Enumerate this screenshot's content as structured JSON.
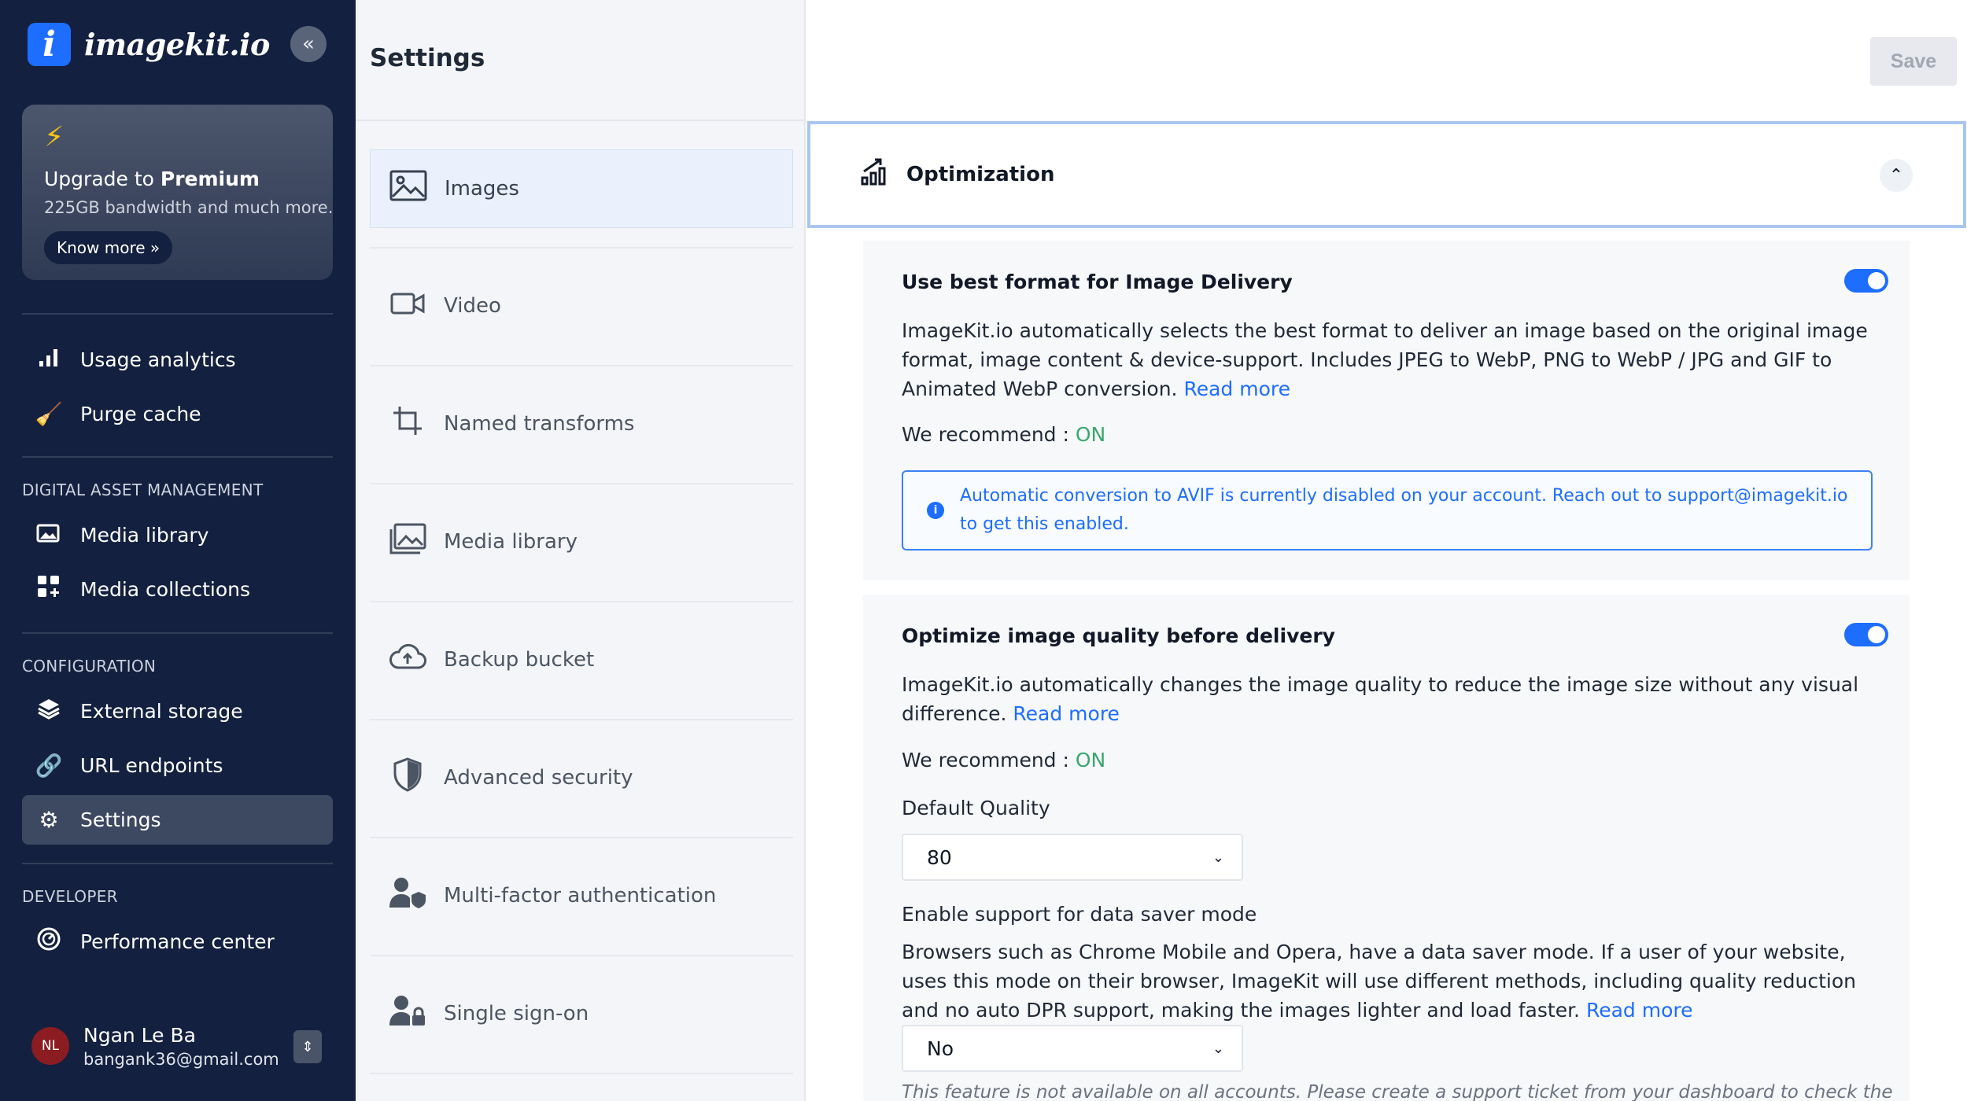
{
  "brand": {
    "logo_letter": "i",
    "name": "imagekit.io"
  },
  "sidebar": {
    "collapse_glyph": "«",
    "upgrade": {
      "title_prefix": "Upgrade to ",
      "title_bold": "Premium",
      "subtitle": "225GB bandwidth and much more.",
      "button": "Know more »"
    },
    "top_items": [
      {
        "label": "Usage analytics",
        "icon": "bar-chart-icon"
      },
      {
        "label": "Purge cache",
        "icon": "broom-icon"
      }
    ],
    "sections": [
      {
        "title": "DIGITAL ASSET MANAGEMENT",
        "items": [
          {
            "label": "Media library",
            "icon": "image-stack-icon"
          },
          {
            "label": "Media collections",
            "icon": "grid-plus-icon"
          }
        ]
      },
      {
        "title": "CONFIGURATION",
        "items": [
          {
            "label": "External storage",
            "icon": "layers-icon"
          },
          {
            "label": "URL endpoints",
            "icon": "link-icon"
          },
          {
            "label": "Settings",
            "icon": "gear-icon",
            "active": true
          }
        ]
      },
      {
        "title": "DEVELOPER",
        "items": [
          {
            "label": "Performance center",
            "icon": "gauge-icon"
          }
        ]
      }
    ],
    "user": {
      "initials": "NL",
      "name": "Ngan Le Ba",
      "email": "bangank36@gmail.com"
    }
  },
  "settings": {
    "title": "Settings",
    "items": [
      {
        "label": "Images",
        "icon": "image-icon",
        "active": true
      },
      {
        "label": "Video",
        "icon": "video-icon"
      },
      {
        "label": "Named transforms",
        "icon": "crop-icon"
      },
      {
        "label": "Media library",
        "icon": "media-library-icon"
      },
      {
        "label": "Backup bucket",
        "icon": "cloud-upload-icon"
      },
      {
        "label": "Advanced security",
        "icon": "shield-icon"
      },
      {
        "label": "Multi-factor authentication",
        "icon": "user-shield-icon"
      },
      {
        "label": "Single sign-on",
        "icon": "user-lock-icon"
      }
    ]
  },
  "main": {
    "save_label": "Save",
    "section_title": "Optimization",
    "best_format": {
      "title": "Use best format for Image Delivery",
      "desc": "ImageKit.io automatically selects the best format to deliver an image based on the original image format, image content & device-support. Includes JPEG to WebP, PNG to WebP / JPG and GIF to Animated WebP conversion.",
      "read_more": "Read more",
      "recommend_label": "We recommend : ",
      "recommend_value": "ON",
      "info": "Automatic conversion to AVIF is currently disabled on your account. Reach out to support@imagekit.io to get this enabled.",
      "enabled": true
    },
    "quality": {
      "title": "Optimize image quality before delivery",
      "desc": "ImageKit.io automatically changes the image quality to reduce the image size without any visual difference.",
      "read_more": "Read more",
      "recommend_label": "We recommend : ",
      "recommend_value": "ON",
      "enabled": true,
      "default_quality_label": "Default Quality",
      "default_quality_value": "80",
      "data_saver_label": "Enable support for data saver mode",
      "data_saver_desc": "Browsers such as Chrome Mobile and Opera, have a data saver mode. If a user of your website, uses this mode on their browser, ImageKit will use different methods, including quality reduction and no auto DPR support, making the images lighter and load faster.",
      "data_saver_read_more": "Read more",
      "data_saver_value": "No",
      "note": "This feature is not available on all accounts. Please create a support ticket from your dashboard to check the"
    }
  }
}
